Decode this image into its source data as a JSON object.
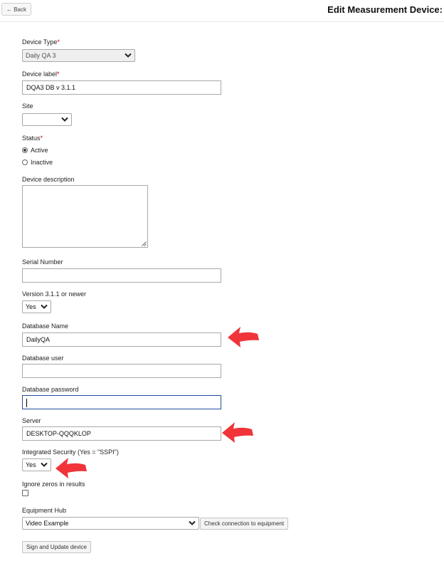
{
  "header": {
    "back_label": "← Back",
    "title": "Edit Measurement Device:"
  },
  "form": {
    "device_type": {
      "label": "Device Type",
      "required_mark": "*",
      "value": "Daily QA 3"
    },
    "device_label": {
      "label": "Device label",
      "required_mark": "*",
      "value": "DQA3 DB v 3.1.1"
    },
    "site": {
      "label": "Site",
      "value": ""
    },
    "status": {
      "label": "Status",
      "required_mark": "*",
      "options": [
        {
          "label": "Active",
          "checked": true
        },
        {
          "label": "Inactive",
          "checked": false
        }
      ]
    },
    "device_description": {
      "label": "Device description",
      "value": ""
    },
    "serial_number": {
      "label": "Serial Number",
      "value": ""
    },
    "version": {
      "label": "Version 3.1.1 or newer",
      "value": "Yes"
    },
    "database_name": {
      "label": "Database Name",
      "value": "DailyQA"
    },
    "database_user": {
      "label": "Database user",
      "value": ""
    },
    "database_password": {
      "label": "Database password",
      "value": ""
    },
    "server": {
      "label": "Server",
      "value": "DESKTOP-QQQKLOP"
    },
    "integrated_security": {
      "label": "Integrated Security (Yes = \"SSPI\")",
      "value": "Yes"
    },
    "ignore_zeros": {
      "label": "Ignore zeros in results",
      "checked": false
    },
    "equipment_hub": {
      "label": "Equipment Hub",
      "value": "Video Example",
      "check_button_label": "Check connection to equipment"
    },
    "submit_label": "Sign and Update device"
  },
  "annotations": {
    "arrow_color": "#f0343a",
    "arrow_icon": "red-arrow-left-icon"
  }
}
